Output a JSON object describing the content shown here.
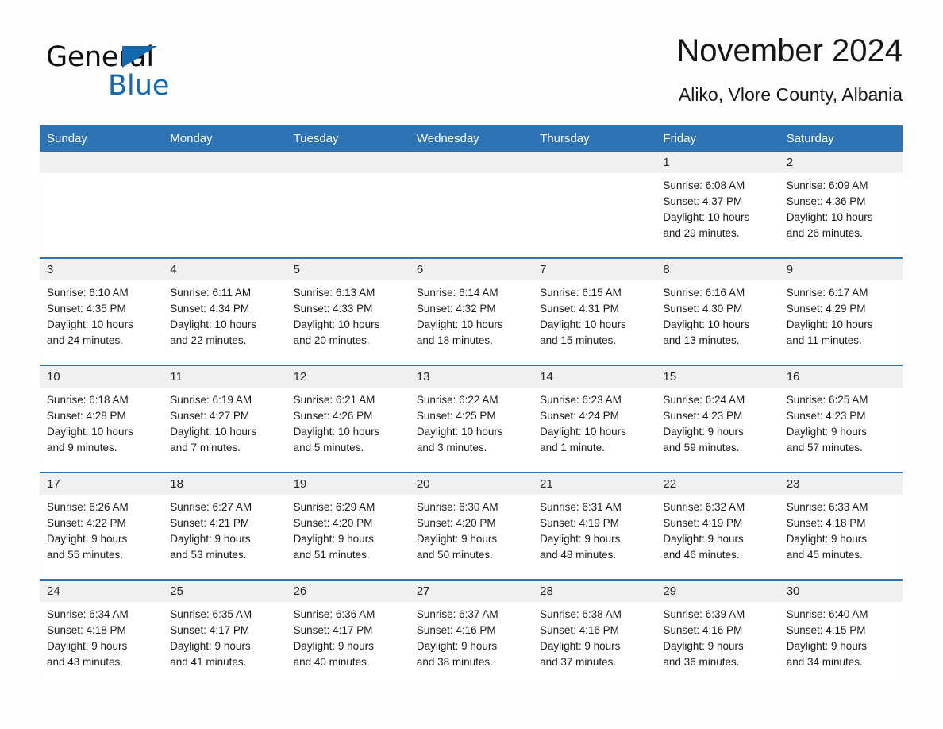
{
  "logo": {
    "word1": "General",
    "word2": "Blue",
    "triangle_color": "#1269b0"
  },
  "header": {
    "title": "November 2024",
    "location": "Aliko, Vlore County, Albania",
    "header_bg_color": "#2e74b5"
  },
  "calendar": {
    "weekday_headers": [
      "Sunday",
      "Monday",
      "Tuesday",
      "Wednesday",
      "Thursday",
      "Friday",
      "Saturday"
    ],
    "weeks": [
      [
        {
          "day": "",
          "sunrise": "",
          "sunset": "",
          "daylight1": "",
          "daylight2": ""
        },
        {
          "day": "",
          "sunrise": "",
          "sunset": "",
          "daylight1": "",
          "daylight2": ""
        },
        {
          "day": "",
          "sunrise": "",
          "sunset": "",
          "daylight1": "",
          "daylight2": ""
        },
        {
          "day": "",
          "sunrise": "",
          "sunset": "",
          "daylight1": "",
          "daylight2": ""
        },
        {
          "day": "",
          "sunrise": "",
          "sunset": "",
          "daylight1": "",
          "daylight2": ""
        },
        {
          "day": "1",
          "sunrise": "Sunrise: 6:08 AM",
          "sunset": "Sunset: 4:37 PM",
          "daylight1": "Daylight: 10 hours",
          "daylight2": "and 29 minutes."
        },
        {
          "day": "2",
          "sunrise": "Sunrise: 6:09 AM",
          "sunset": "Sunset: 4:36 PM",
          "daylight1": "Daylight: 10 hours",
          "daylight2": "and 26 minutes."
        }
      ],
      [
        {
          "day": "3",
          "sunrise": "Sunrise: 6:10 AM",
          "sunset": "Sunset: 4:35 PM",
          "daylight1": "Daylight: 10 hours",
          "daylight2": "and 24 minutes."
        },
        {
          "day": "4",
          "sunrise": "Sunrise: 6:11 AM",
          "sunset": "Sunset: 4:34 PM",
          "daylight1": "Daylight: 10 hours",
          "daylight2": "and 22 minutes."
        },
        {
          "day": "5",
          "sunrise": "Sunrise: 6:13 AM",
          "sunset": "Sunset: 4:33 PM",
          "daylight1": "Daylight: 10 hours",
          "daylight2": "and 20 minutes."
        },
        {
          "day": "6",
          "sunrise": "Sunrise: 6:14 AM",
          "sunset": "Sunset: 4:32 PM",
          "daylight1": "Daylight: 10 hours",
          "daylight2": "and 18 minutes."
        },
        {
          "day": "7",
          "sunrise": "Sunrise: 6:15 AM",
          "sunset": "Sunset: 4:31 PM",
          "daylight1": "Daylight: 10 hours",
          "daylight2": "and 15 minutes."
        },
        {
          "day": "8",
          "sunrise": "Sunrise: 6:16 AM",
          "sunset": "Sunset: 4:30 PM",
          "daylight1": "Daylight: 10 hours",
          "daylight2": "and 13 minutes."
        },
        {
          "day": "9",
          "sunrise": "Sunrise: 6:17 AM",
          "sunset": "Sunset: 4:29 PM",
          "daylight1": "Daylight: 10 hours",
          "daylight2": "and 11 minutes."
        }
      ],
      [
        {
          "day": "10",
          "sunrise": "Sunrise: 6:18 AM",
          "sunset": "Sunset: 4:28 PM",
          "daylight1": "Daylight: 10 hours",
          "daylight2": "and 9 minutes."
        },
        {
          "day": "11",
          "sunrise": "Sunrise: 6:19 AM",
          "sunset": "Sunset: 4:27 PM",
          "daylight1": "Daylight: 10 hours",
          "daylight2": "and 7 minutes."
        },
        {
          "day": "12",
          "sunrise": "Sunrise: 6:21 AM",
          "sunset": "Sunset: 4:26 PM",
          "daylight1": "Daylight: 10 hours",
          "daylight2": "and 5 minutes."
        },
        {
          "day": "13",
          "sunrise": "Sunrise: 6:22 AM",
          "sunset": "Sunset: 4:25 PM",
          "daylight1": "Daylight: 10 hours",
          "daylight2": "and 3 minutes."
        },
        {
          "day": "14",
          "sunrise": "Sunrise: 6:23 AM",
          "sunset": "Sunset: 4:24 PM",
          "daylight1": "Daylight: 10 hours",
          "daylight2": "and 1 minute."
        },
        {
          "day": "15",
          "sunrise": "Sunrise: 6:24 AM",
          "sunset": "Sunset: 4:23 PM",
          "daylight1": "Daylight: 9 hours",
          "daylight2": "and 59 minutes."
        },
        {
          "day": "16",
          "sunrise": "Sunrise: 6:25 AM",
          "sunset": "Sunset: 4:23 PM",
          "daylight1": "Daylight: 9 hours",
          "daylight2": "and 57 minutes."
        }
      ],
      [
        {
          "day": "17",
          "sunrise": "Sunrise: 6:26 AM",
          "sunset": "Sunset: 4:22 PM",
          "daylight1": "Daylight: 9 hours",
          "daylight2": "and 55 minutes."
        },
        {
          "day": "18",
          "sunrise": "Sunrise: 6:27 AM",
          "sunset": "Sunset: 4:21 PM",
          "daylight1": "Daylight: 9 hours",
          "daylight2": "and 53 minutes."
        },
        {
          "day": "19",
          "sunrise": "Sunrise: 6:29 AM",
          "sunset": "Sunset: 4:20 PM",
          "daylight1": "Daylight: 9 hours",
          "daylight2": "and 51 minutes."
        },
        {
          "day": "20",
          "sunrise": "Sunrise: 6:30 AM",
          "sunset": "Sunset: 4:20 PM",
          "daylight1": "Daylight: 9 hours",
          "daylight2": "and 50 minutes."
        },
        {
          "day": "21",
          "sunrise": "Sunrise: 6:31 AM",
          "sunset": "Sunset: 4:19 PM",
          "daylight1": "Daylight: 9 hours",
          "daylight2": "and 48 minutes."
        },
        {
          "day": "22",
          "sunrise": "Sunrise: 6:32 AM",
          "sunset": "Sunset: 4:19 PM",
          "daylight1": "Daylight: 9 hours",
          "daylight2": "and 46 minutes."
        },
        {
          "day": "23",
          "sunrise": "Sunrise: 6:33 AM",
          "sunset": "Sunset: 4:18 PM",
          "daylight1": "Daylight: 9 hours",
          "daylight2": "and 45 minutes."
        }
      ],
      [
        {
          "day": "24",
          "sunrise": "Sunrise: 6:34 AM",
          "sunset": "Sunset: 4:18 PM",
          "daylight1": "Daylight: 9 hours",
          "daylight2": "and 43 minutes."
        },
        {
          "day": "25",
          "sunrise": "Sunrise: 6:35 AM",
          "sunset": "Sunset: 4:17 PM",
          "daylight1": "Daylight: 9 hours",
          "daylight2": "and 41 minutes."
        },
        {
          "day": "26",
          "sunrise": "Sunrise: 6:36 AM",
          "sunset": "Sunset: 4:17 PM",
          "daylight1": "Daylight: 9 hours",
          "daylight2": "and 40 minutes."
        },
        {
          "day": "27",
          "sunrise": "Sunrise: 6:37 AM",
          "sunset": "Sunset: 4:16 PM",
          "daylight1": "Daylight: 9 hours",
          "daylight2": "and 38 minutes."
        },
        {
          "day": "28",
          "sunrise": "Sunrise: 6:38 AM",
          "sunset": "Sunset: 4:16 PM",
          "daylight1": "Daylight: 9 hours",
          "daylight2": "and 37 minutes."
        },
        {
          "day": "29",
          "sunrise": "Sunrise: 6:39 AM",
          "sunset": "Sunset: 4:16 PM",
          "daylight1": "Daylight: 9 hours",
          "daylight2": "and 36 minutes."
        },
        {
          "day": "30",
          "sunrise": "Sunrise: 6:40 AM",
          "sunset": "Sunset: 4:15 PM",
          "daylight1": "Daylight: 9 hours",
          "daylight2": "and 34 minutes."
        }
      ]
    ]
  }
}
